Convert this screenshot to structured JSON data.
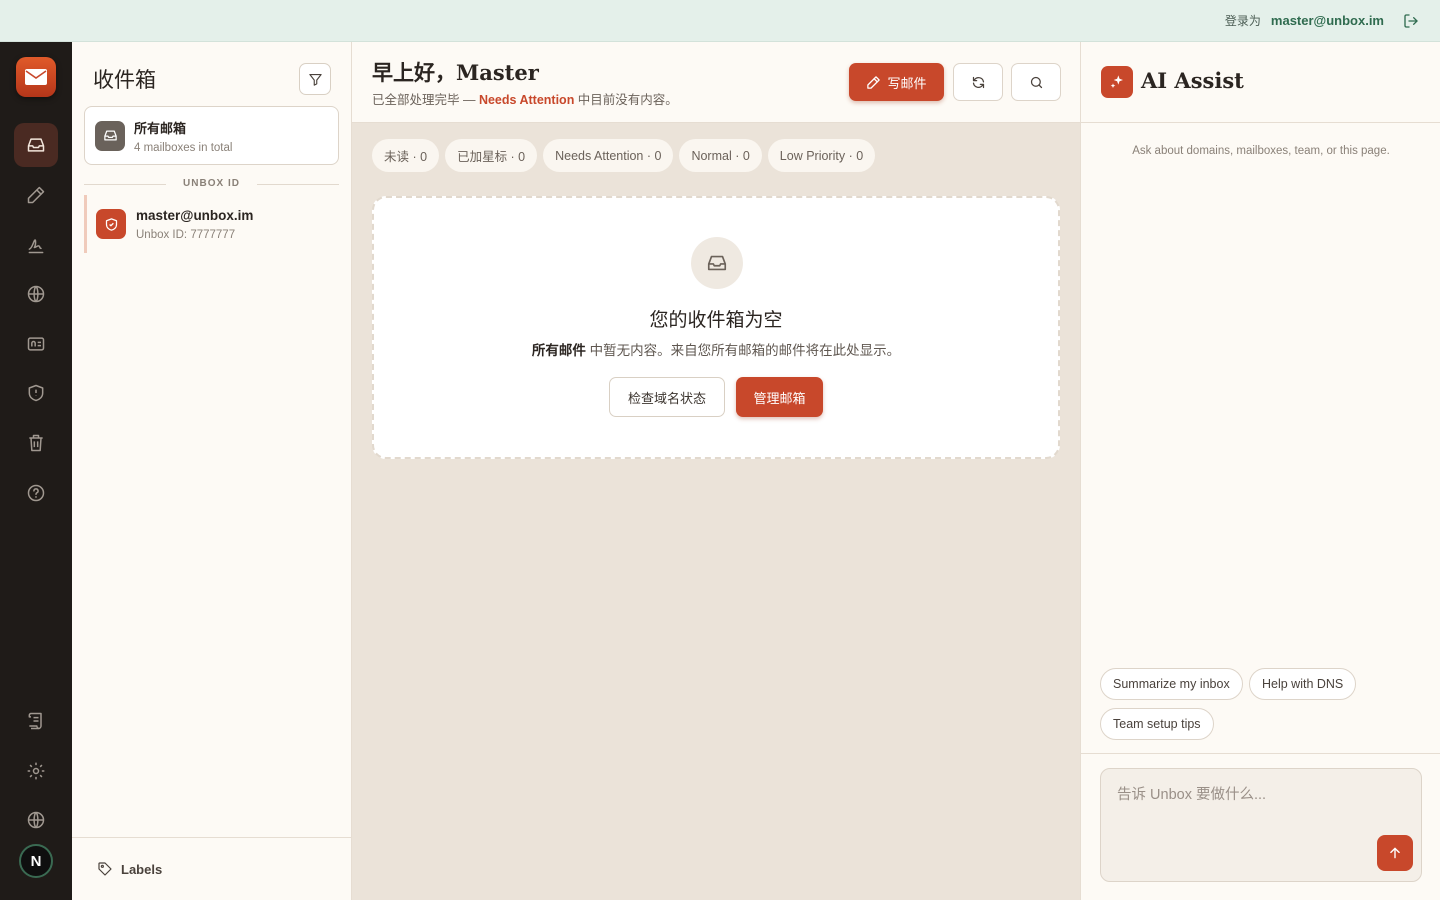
{
  "topbar": {
    "login_label": "登录为",
    "user": "master@unbox.im"
  },
  "sidebar": {
    "icons": [
      "mail-app-logo",
      "inbox-icon",
      "compose-icon",
      "signature-icon",
      "globe-icon",
      "id-card-icon",
      "shield-icon",
      "trash-icon",
      "help-icon",
      "scroll-icon",
      "gear-icon",
      "language-globe-icon"
    ],
    "avatar_letter": "N"
  },
  "mailboxes": {
    "title": "收件箱",
    "all": {
      "name": "所有邮箱",
      "sub": "4 mailboxes in total"
    },
    "section_label": "UNBOX ID",
    "items": [
      {
        "name": "master@unbox.im",
        "sub": "Unbox ID: 7777777"
      }
    ],
    "labels": "Labels"
  },
  "main": {
    "greeting": "早上好，Master",
    "subline_pre": "已全部处理完毕 — ",
    "subline_hl": "Needs Attention",
    "subline_post": " 中目前没有内容。",
    "compose": "写邮件",
    "chips": [
      "未读 · 0",
      "已加星标 · 0",
      "Needs Attention · 0",
      "Normal · 0",
      "Low Priority · 0"
    ],
    "empty": {
      "title": "您的收件箱为空",
      "desc_bold": "所有邮件",
      "desc_rest": " 中暂无内容。来自您所有邮箱的邮件将在此处显示。",
      "btn_check": "检查域名状态",
      "btn_manage": "管理邮箱"
    }
  },
  "ai": {
    "title": "AI Assist",
    "hint": "Ask about domains, mailboxes, team, or this page.",
    "suggestions": [
      "Summarize my inbox",
      "Help with DNS",
      "Team setup tips"
    ],
    "placeholder": "告诉 Unbox 要做什么..."
  },
  "colors": {
    "accent": "#c8482b",
    "sidebar": "#1f1b18",
    "topbar": "#e4f0ea"
  }
}
